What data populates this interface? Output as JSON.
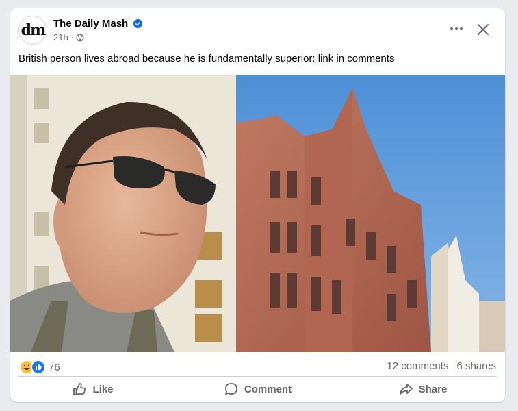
{
  "post": {
    "page_name": "The Daily Mash",
    "avatar_text": "dm",
    "time": "21h ·",
    "caption": "British person lives abroad because he is fundamentally superior: link in comments",
    "more_label": "•••",
    "reactions": {
      "icons": [
        "haha-icon",
        "like-icon"
      ],
      "count": "76"
    },
    "comments": "12 comments",
    "shares": "6 shares",
    "actions": {
      "like": "Like",
      "comment": "Comment",
      "share": "Share"
    }
  },
  "colors": {
    "brand_blue": "#0866ff",
    "muted_text": "#65676b",
    "sky": "#5b9ad8",
    "building_brick": "#b46a55"
  }
}
